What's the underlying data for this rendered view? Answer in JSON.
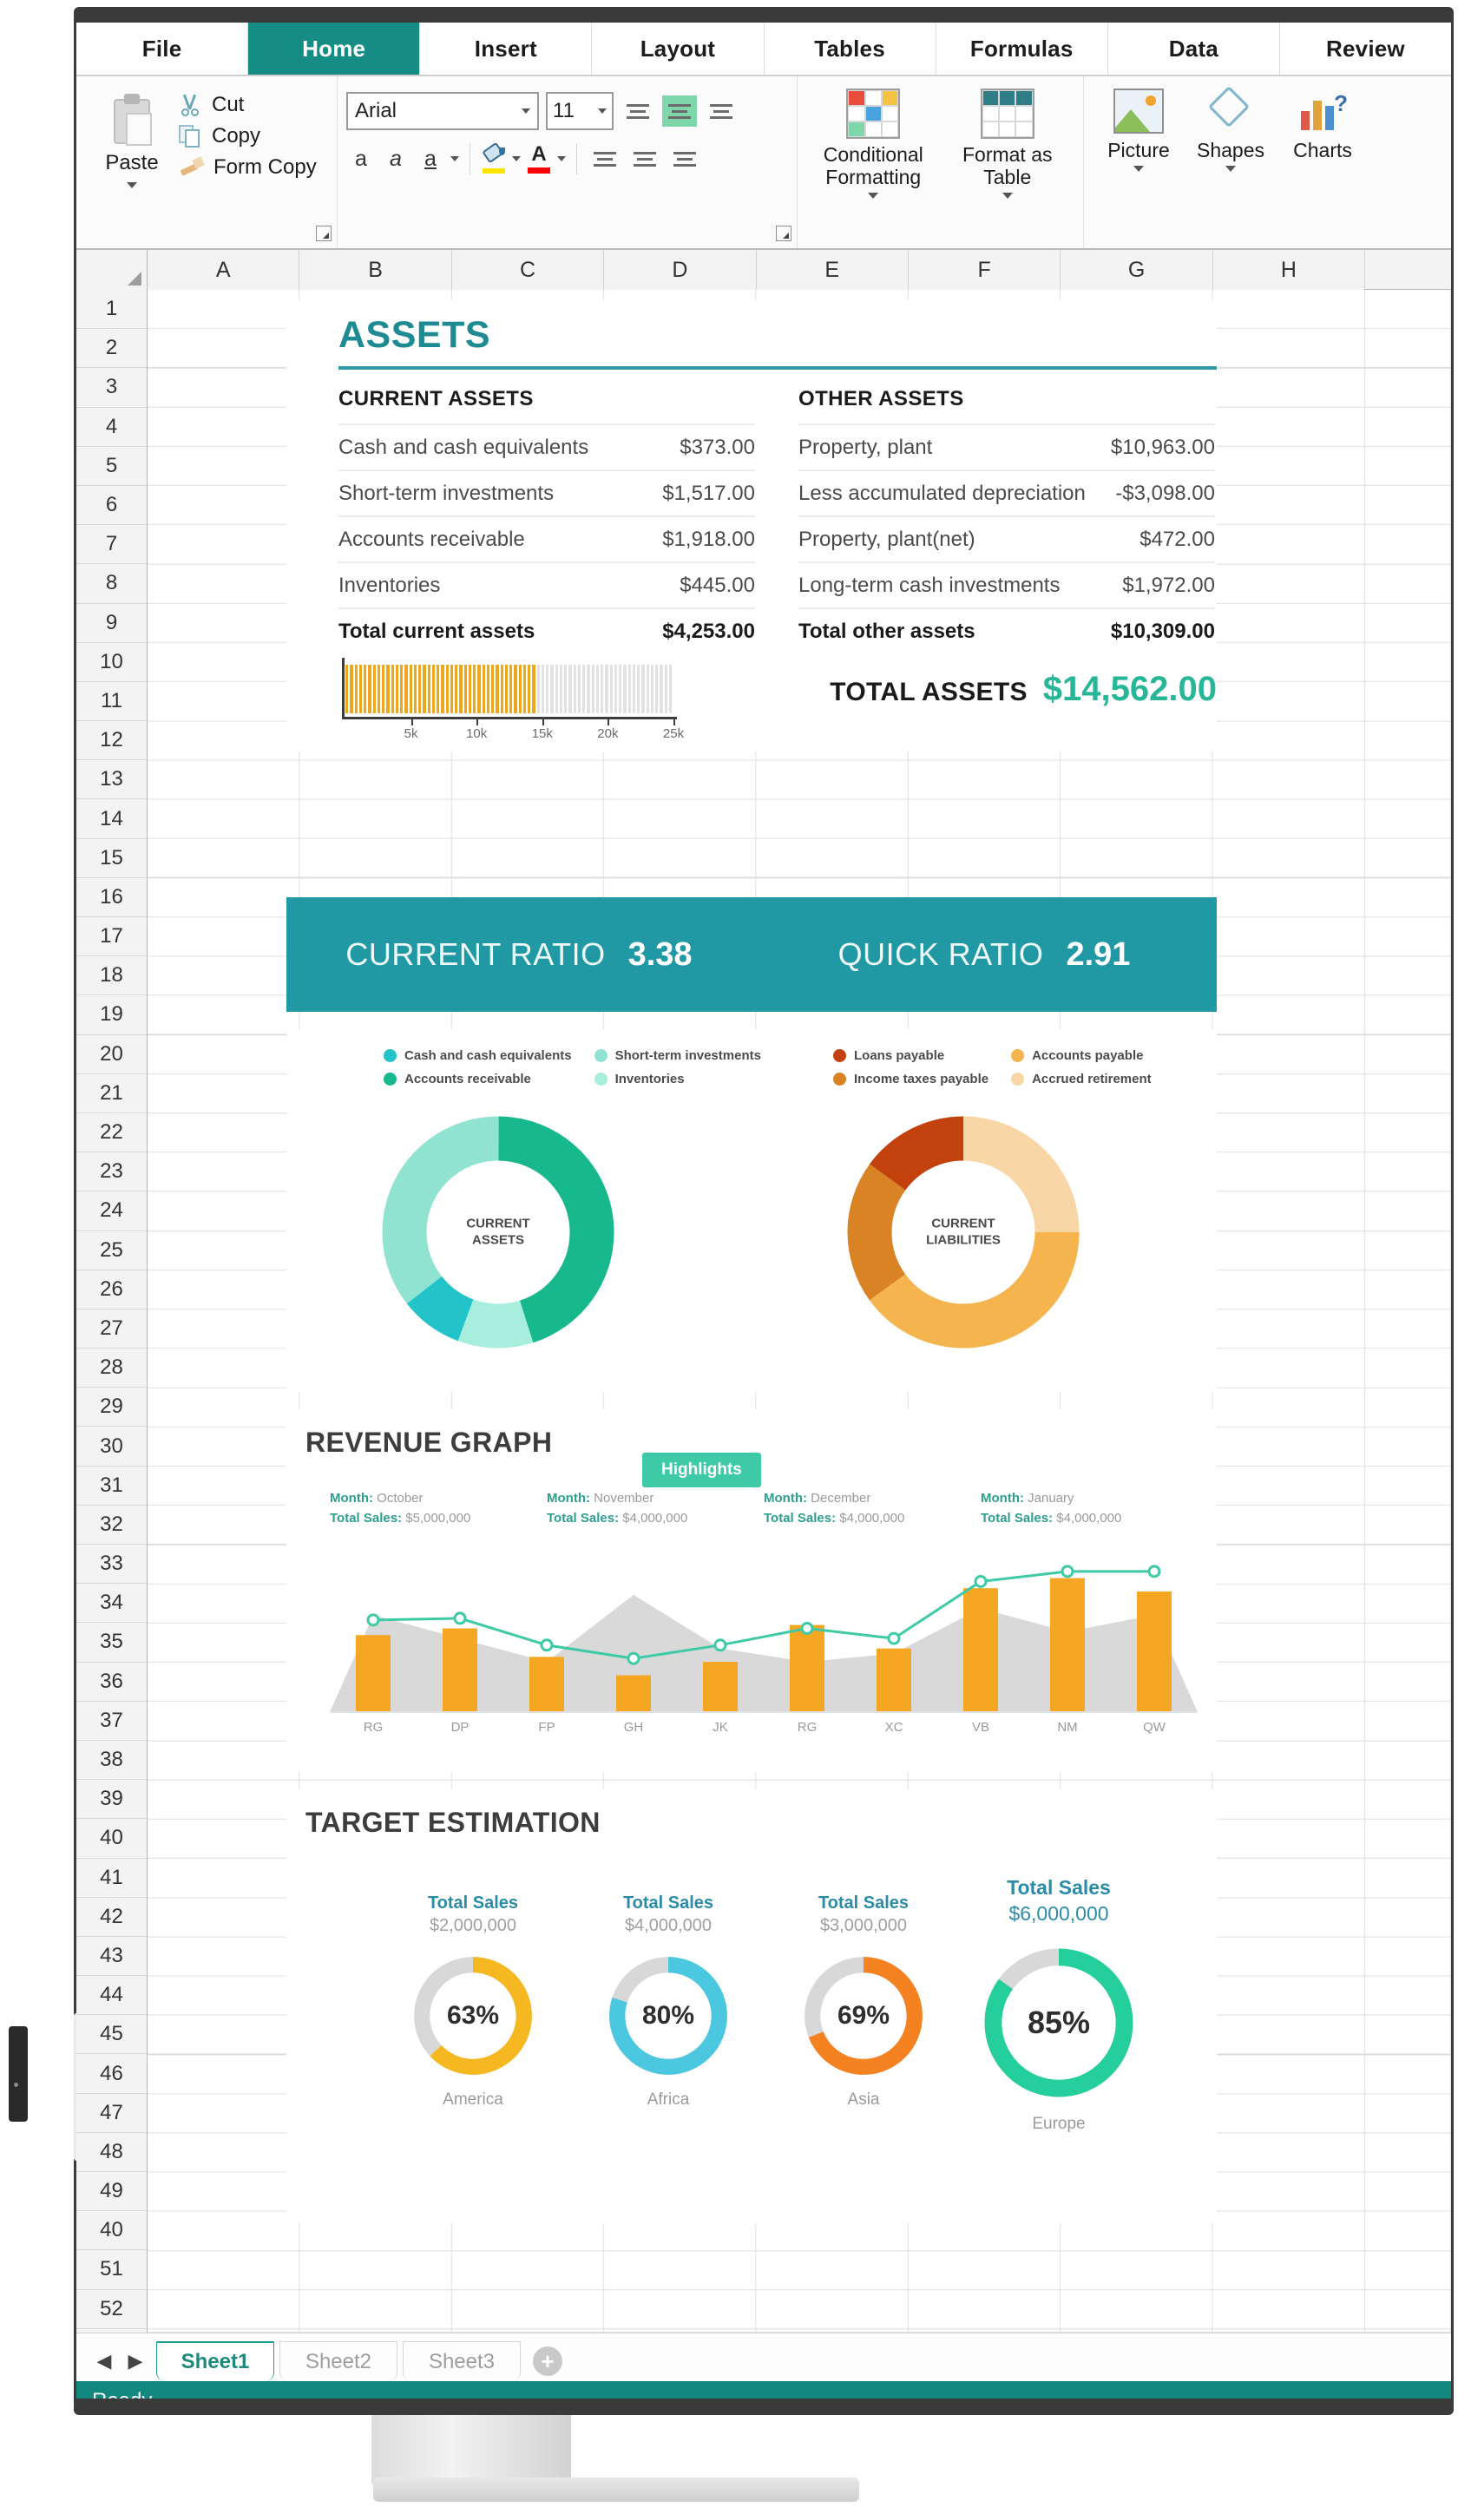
{
  "app": {
    "status_text": "Ready"
  },
  "ribbon": {
    "tabs": [
      {
        "label": "File",
        "active": false
      },
      {
        "label": "Home",
        "active": true
      },
      {
        "label": "Insert",
        "active": false
      },
      {
        "label": "Layout",
        "active": false
      },
      {
        "label": "Tables",
        "active": false
      },
      {
        "label": "Formulas",
        "active": false
      },
      {
        "label": "Data",
        "active": false
      },
      {
        "label": "Review",
        "active": false
      }
    ],
    "clipboard": {
      "paste_label": "Paste",
      "cut_label": "Cut",
      "copy_label": "Copy",
      "format_copy_label": "Form Copy"
    },
    "font": {
      "font_name": "Arial",
      "font_size": "11",
      "bold_label": "a",
      "italic_label": "a",
      "underline_label": "a",
      "font_color_label": "A"
    },
    "styles": {
      "conditional_formatting_label": "Conditional Formatting",
      "format_as_table_label": "Format as Table"
    },
    "insert": {
      "picture_label": "Picture",
      "shapes_label": "Shapes",
      "charts_label": "Charts"
    }
  },
  "grid": {
    "columns": [
      "A",
      "B",
      "C",
      "D",
      "E",
      "F",
      "G",
      "H"
    ],
    "rows": [
      "1",
      "2",
      "3",
      "4",
      "5",
      "6",
      "7",
      "8",
      "9",
      "10",
      "11",
      "12",
      "13",
      "14",
      "15",
      "16",
      "17",
      "18",
      "19",
      "20",
      "21",
      "22",
      "23",
      "24",
      "25",
      "26",
      "27",
      "28",
      "29",
      "30",
      "31",
      "32",
      "33",
      "34",
      "35",
      "36",
      "37",
      "38",
      "39",
      "40",
      "41",
      "42",
      "43",
      "44",
      "45",
      "46",
      "47",
      "48",
      "49",
      "40",
      "51",
      "52"
    ]
  },
  "dashboard": {
    "assets": {
      "title": "ASSETS",
      "current": {
        "heading": "CURRENT ASSETS",
        "rows": [
          {
            "label": "Cash and cash equivalents",
            "value": "$373.00"
          },
          {
            "label": "Short-term investments",
            "value": "$1,517.00"
          },
          {
            "label": "Accounts receivable",
            "value": "$1,918.00"
          },
          {
            "label": "Inventories",
            "value": "$445.00"
          }
        ],
        "total": {
          "label": "Total current assets",
          "value": "$4,253.00"
        }
      },
      "other": {
        "heading": "OTHER ASSETS",
        "rows": [
          {
            "label": "Property, plant",
            "value": "$10,963.00"
          },
          {
            "label": "Less accumulated depreciation",
            "value": "-$3,098.00"
          },
          {
            "label": "Property, plant(net)",
            "value": "$472.00"
          },
          {
            "label": "Long-term cash investments",
            "value": "$1,972.00"
          }
        ],
        "total": {
          "label": "Total other assets",
          "value": "$10,309.00"
        }
      },
      "total_assets": {
        "label": "TOTAL ASSETS",
        "value": "$14,562.00"
      }
    },
    "ratios": [
      {
        "label": "CURRENT RATIO",
        "value": "3.38"
      },
      {
        "label": "QUICK RATIO",
        "value": "2.91"
      }
    ],
    "donuts": {
      "left_center": "CURRENT\nASSETS",
      "left_center_line1": "CURRENT",
      "left_center_line2": "ASSETS",
      "right_center_line1": "CURRENT",
      "right_center_line2": "LIABILITIES",
      "left_legend": [
        {
          "label": "Cash and cash equivalents",
          "color": "#22c3c9"
        },
        {
          "label": "Short-term investments",
          "color": "#8fe3d0"
        },
        {
          "label": "Accounts receivable",
          "color": "#18b88e"
        },
        {
          "label": "Inventories",
          "color": "#a7eedd"
        }
      ],
      "right_legend": [
        {
          "label": "Loans payable",
          "color": "#c2410c"
        },
        {
          "label": "Accounts payable",
          "color": "#f5b44d"
        },
        {
          "label": "Income taxes payable",
          "color": "#d98324"
        },
        {
          "label": "Accrued retirement",
          "color": "#f8d6a6"
        }
      ]
    },
    "revenue": {
      "title": "REVENUE GRAPH",
      "highlight_label": "Highlights",
      "month_label": "Month:",
      "sales_label": "Total Sales:",
      "months": [
        {
          "month": "October",
          "sales": "$5,000,000"
        },
        {
          "month": "November",
          "sales": "$4,000,000"
        },
        {
          "month": "December",
          "sales": "$4,000,000"
        },
        {
          "month": "January",
          "sales": "$4,000,000"
        }
      ]
    },
    "target": {
      "title": "TARGET ESTIMATION",
      "sales_label": "Total Sales",
      "items": [
        {
          "region": "America",
          "percent": "63%",
          "sales": "$2,000,000",
          "color": "#f5b820",
          "pct_num": 63
        },
        {
          "region": "Africa",
          "percent": "80%",
          "sales": "$4,000,000",
          "color": "#4cc7e0",
          "pct_num": 80
        },
        {
          "region": "Asia",
          "percent": "69%",
          "sales": "$3,000,000",
          "color": "#f58220",
          "pct_num": 69
        },
        {
          "region": "Europe",
          "percent": "85%",
          "sales": "$6,000,000",
          "color": "#25cf9b",
          "pct_num": 85
        }
      ]
    }
  },
  "sheet_tabs": [
    {
      "label": "Sheet1",
      "active": true
    },
    {
      "label": "Sheet2",
      "active": false
    },
    {
      "label": "Sheet3",
      "active": false
    }
  ],
  "add_sheet_label": "+",
  "nav_prev": "◀",
  "nav_next": "▶",
  "chart_data": [
    {
      "type": "bar",
      "name": "total-assets-progress",
      "title": "TOTAL ASSETS",
      "orientation": "horizontal",
      "value": 14562,
      "xlim": [
        0,
        25000
      ],
      "tick_labels": [
        "5k",
        "10k",
        "15k",
        "20k",
        "25k"
      ],
      "tick_values": [
        5000,
        10000,
        15000,
        20000,
        25000
      ],
      "filled_color": "#eaa81e",
      "track_color": "#e2e2e2"
    },
    {
      "type": "pie",
      "name": "current-assets-donut",
      "title": "CURRENT ASSETS",
      "labels": [
        "Cash and cash equivalents",
        "Short-term investments",
        "Accounts receivable",
        "Inventories"
      ],
      "values": [
        373,
        1517,
        1918,
        445
      ],
      "percents": [
        8.8,
        35.7,
        45.1,
        10.5
      ],
      "colors": [
        "#22c3c9",
        "#8fe3d0",
        "#18b88e",
        "#a7eedd"
      ],
      "legend_position": "top"
    },
    {
      "type": "pie",
      "name": "current-liabilities-donut",
      "title": "CURRENT LIABILITIES",
      "labels": [
        "Loans payable",
        "Accounts payable",
        "Income taxes payable",
        "Accrued retirement"
      ],
      "values": [
        15,
        40,
        20,
        25
      ],
      "percents": [
        15,
        40,
        20,
        25
      ],
      "colors": [
        "#c2410c",
        "#f5b44d",
        "#d98324",
        "#f8d6a6"
      ],
      "legend_position": "top"
    },
    {
      "type": "bar",
      "name": "revenue-graph",
      "title": "REVENUE GRAPH",
      "categories": [
        "RG",
        "DP",
        "FP",
        "GH",
        "JK",
        "RG",
        "XC",
        "VB",
        "NM",
        "QW"
      ],
      "series": [
        {
          "name": "Sales (orange bars)",
          "values": [
            46,
            50,
            33,
            22,
            30,
            52,
            38,
            74,
            80,
            72
          ]
        },
        {
          "name": "Area (grey)",
          "values": [
            58,
            44,
            30,
            70,
            38,
            30,
            35,
            62,
            48,
            58
          ]
        },
        {
          "name": "Trend (green line)",
          "values": [
            55,
            56,
            40,
            32,
            40,
            50,
            44,
            78,
            84,
            84
          ]
        }
      ],
      "ylim": [
        0,
        100
      ],
      "grid": false
    },
    {
      "type": "pie",
      "name": "target-estimation-gauges",
      "title": "TARGET ESTIMATION",
      "categories": [
        "America",
        "Africa",
        "Asia",
        "Europe"
      ],
      "values": [
        63,
        80,
        69,
        85
      ],
      "labels": [
        "63%",
        "80%",
        "69%",
        "85%"
      ],
      "annotations": [
        "$2,000,000",
        "$4,000,000",
        "$3,000,000",
        "$6,000,000"
      ],
      "colors": [
        "#f5b820",
        "#4cc7e0",
        "#f58220",
        "#25cf9b"
      ],
      "track_color": "#d8d8d8"
    }
  ]
}
